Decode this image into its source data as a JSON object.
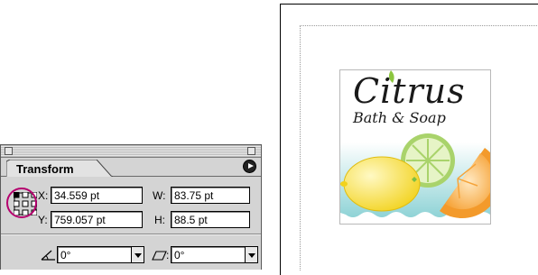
{
  "panel": {
    "tab_label": "Transform",
    "x_label": "X:",
    "x_value": "34.559 pt",
    "y_label": "Y:",
    "y_value": "759.057 pt",
    "w_label": "W:",
    "w_value": "83.75 pt",
    "h_label": "H:",
    "h_value": "88.5 pt",
    "rotate_value": "0°",
    "shear_value": "0°",
    "highlight_color": "#b5006e"
  },
  "artwork": {
    "brand_name": "Citrus",
    "brand_tagline": "Bath & Soap"
  },
  "icons": {
    "panel_menu": "triangle-menu-icon",
    "reference_point": "reference-point-grid-icon",
    "rotate": "rotate-angle-icon",
    "shear": "shear-angle-icon"
  }
}
